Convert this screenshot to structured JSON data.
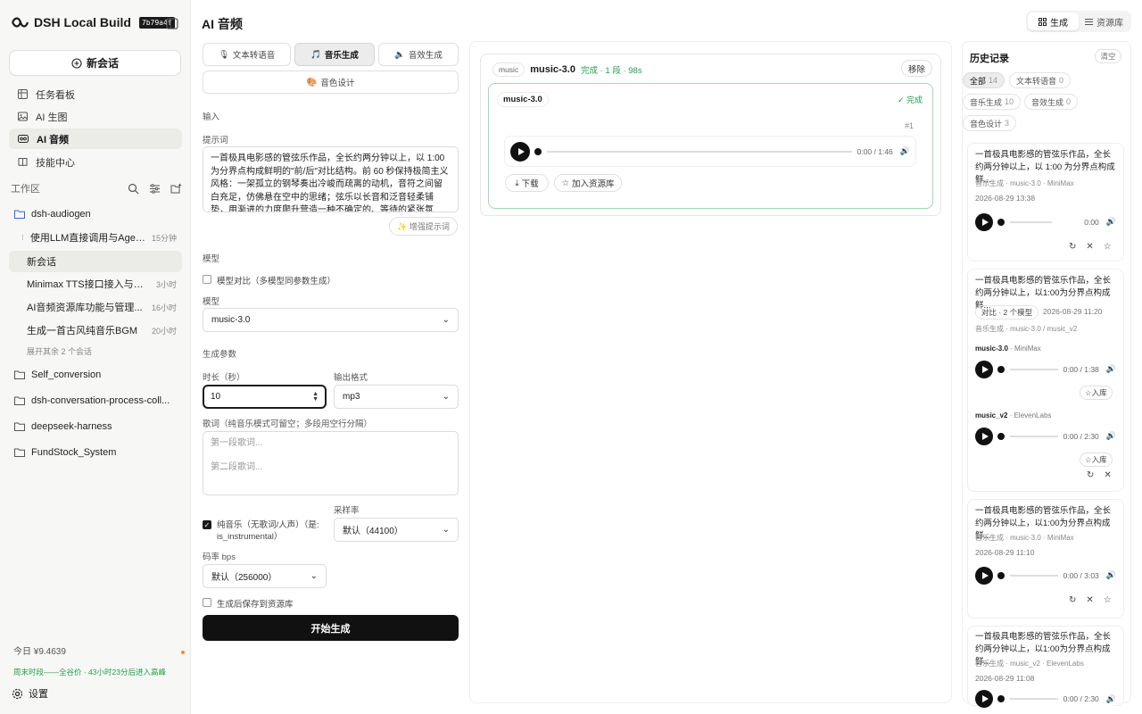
{
  "brand": {
    "name": "DSH Local Build",
    "build": "7b79a4f"
  },
  "sidebar": {
    "new_chat": "新会话",
    "nav": [
      {
        "label": "任务看板",
        "icon": "kanban-icon"
      },
      {
        "label": "AI 生图",
        "icon": "image-icon"
      },
      {
        "label": "AI 音频",
        "icon": "audio-icon",
        "active": true
      },
      {
        "label": "技能中心",
        "icon": "book-icon"
      }
    ],
    "workspace_label": "工作区",
    "folder_open": "dsh-audiogen",
    "sessions": [
      {
        "title": "使用LLM直接调用与Agent...",
        "time": "15分钟"
      },
      {
        "title": "新会话",
        "time": ""
      },
      {
        "title": "Minimax TTS接口接入与字...",
        "time": "3小时"
      },
      {
        "title": "AI音频资源库功能与管理...",
        "time": "16小时"
      },
      {
        "title": "生成一首古风纯音乐BGM",
        "time": "20小时"
      }
    ],
    "expand_more": "展开其余 2 个会话",
    "folders": [
      "Self_conversion",
      "dsh-conversation-process-coll...",
      "deepseek-harness",
      "FundStock_System"
    ],
    "cost": "今日 ¥9.4639",
    "promo": "周末时段——全谷价 · 43小时23分后进入高峰",
    "settings": "设置"
  },
  "header": {
    "title": "AI 音频",
    "view_generate": "生成",
    "view_library": "资源库"
  },
  "tabs": [
    "文本转语音",
    "音乐生成",
    "音效生成",
    "音色设计"
  ],
  "form": {
    "section_input": "输入",
    "prompt_label": "提示词",
    "prompt_text": "一首极具电影感的管弦乐作品，全长约两分钟以上，以 1:00 为分界点构成鲜明的\"前/后\"对比结构。前 60 秒保持极简主义风格：一架孤立的钢琴奏出冷峻而疏离的动机，音符之间留白充足，仿佛悬在空中的思绪；弦乐以长音和泛音轻柔铺垫，用渐进的力度爬升营造一种不确定的、等待的紧张氛围。",
    "enhance": "✨ 增强提示词",
    "section_model": "模型",
    "compare_label": "模型对比（多模型同参数生成）",
    "model_label": "模型",
    "model_value": "music-3.0",
    "section_params": "生成参数",
    "duration_label": "时长（秒）",
    "duration_value": "10",
    "format_label": "输出格式",
    "format_value": "mp3",
    "lyrics_label": "歌词（纯音乐模式可留空；多段用空行分隔）",
    "lyrics_ph1": "第一段歌词...",
    "lyrics_ph2": "第二段歌词...",
    "instrumental_label": "纯音乐（无歌词/人声）（是: is_instrumental）",
    "samplerate_label": "采样率",
    "samplerate_value": "默认（44100）",
    "bitrate_label": "码率 bps",
    "bitrate_value": "默认（256000）",
    "save_label": "生成后保存到资源库",
    "generate": "开始生成"
  },
  "result": {
    "type_pill": "music",
    "model": "music-3.0",
    "status": "完成 · 1 段 · 98s",
    "remove": "移除",
    "audio_name": "music-3.0",
    "done": "✓ 完成",
    "index": "#1",
    "time": "0:00 / 1:46",
    "download": "下载",
    "add_library": "加入资源库"
  },
  "history": {
    "title": "历史记录",
    "clear": "清空",
    "filters": [
      {
        "label": "全部",
        "count": "14"
      },
      {
        "label": "文本转语音",
        "count": "0"
      },
      {
        "label": "音乐生成",
        "count": "10"
      },
      {
        "label": "音效生成",
        "count": "0"
      },
      {
        "label": "音色设计",
        "count": "3"
      }
    ],
    "items": [
      {
        "text": "一首极具电影感的管弦乐作品，全长约两分钟以上，以 1:00 为分界点构成鲜...",
        "meta": "音乐生成 · music-3.0 · MiniMax",
        "date": "2026-08-29 13:38",
        "time": "0:00"
      },
      {
        "text": "一首极具电影感的管弦乐作品，全长约两分钟以上，以1:00为分界点构成鲜...",
        "tag": "对比 · 2 个模型",
        "date": "2026-08-29 11:20",
        "meta": "音乐生成 · music-3.0 / music_v2",
        "subs": [
          {
            "model": "music-3.0",
            "vendor": "· MiniMax",
            "time": "0:00 / 1:38",
            "btn": "入库"
          },
          {
            "model": "music_v2",
            "vendor": "· ElevenLabs",
            "time": "0:00 / 2:30",
            "btn": "入库"
          }
        ]
      },
      {
        "text": "一首极具电影感的管弦乐作品，全长约两分钟以上，以1:00为分界点构成鲜...",
        "meta": "音乐生成 · music-3.0 · MiniMax",
        "date": "2026-08-29 11:10",
        "time": "0:00 / 3:03"
      },
      {
        "text": "一首极具电影感的管弦乐作品，全长约两分钟以上，以1:00为分界点构成鲜...",
        "meta": "音乐生成 · music_v2 · ElevenLabs",
        "date": "2026-08-29 11:08",
        "time": "0:00 / 2:30"
      }
    ]
  }
}
